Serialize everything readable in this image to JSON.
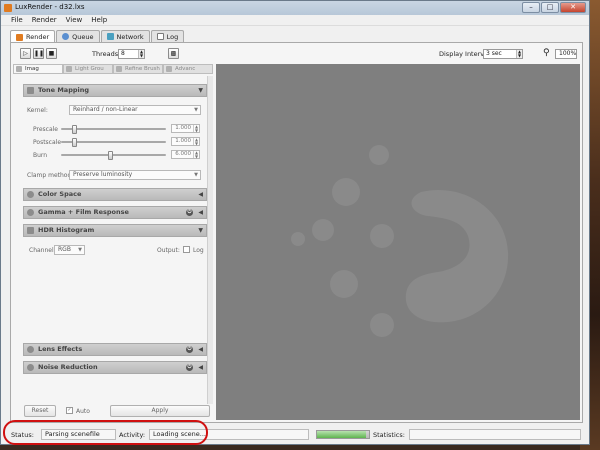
{
  "window": {
    "title": "LuxRender - d32.lxs"
  },
  "menu": [
    "File",
    "Render",
    "View",
    "Help"
  ],
  "tabs": [
    {
      "label": "Render",
      "color": "#e07b20"
    },
    {
      "label": "Queue",
      "color": "#5a8fd0"
    },
    {
      "label": "Network",
      "color": "#4aa0c0"
    },
    {
      "label": "Log",
      "color": "#7a7a7a"
    }
  ],
  "toolbar": {
    "threads_label": "Threads:",
    "threads_value": "8",
    "display_interval_label": "Display Interval:",
    "display_interval_value": "3 sec",
    "zoom_value": "100%"
  },
  "panel_tabs": [
    "Imag",
    "Light Grou",
    "Refine Brush",
    "Advanc"
  ],
  "tone_mapping": {
    "title": "Tone Mapping",
    "kernel_label": "Kernel:",
    "kernel_value": "Reinhard / non-Linear",
    "prescale_label": "Prescale",
    "prescale_value": "1.000",
    "prescale_level": 0.1,
    "postscale_label": "Postscale",
    "postscale_value": "1.000",
    "postscale_level": 0.1,
    "burn_label": "Burn",
    "burn_value": "6.000",
    "burn_level": 0.47,
    "clamp_label": "Clamp method:",
    "clamp_value": "Preserve luminosity"
  },
  "sections": {
    "color_space": "Color Space",
    "gamma": "Gamma + Film Response",
    "hdr": "HDR Histogram",
    "lens": "Lens Effects",
    "noise": "Noise Reduction"
  },
  "histogram": {
    "channel_label": "Channel:",
    "channel_value": "RGB",
    "output_label": "Output:",
    "log_label": "Log"
  },
  "buttons": {
    "reset": "Reset",
    "auto": "Auto",
    "apply": "Apply"
  },
  "status": {
    "status_label": "Status:",
    "status_value": "Parsing scenefile",
    "activity_label": "Activity:",
    "activity_value": "Loading scene...",
    "statistics_label": "Statistics:",
    "progress": 0.95
  }
}
